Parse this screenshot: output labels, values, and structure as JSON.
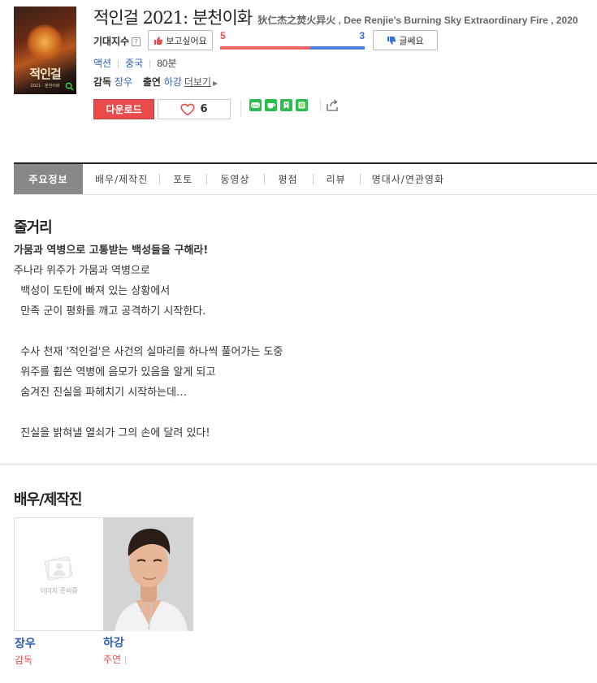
{
  "movie": {
    "title": "적인걸 2021: 분천이화",
    "original_title": "狄仁杰之焚火异火 , Dee Renjie's Burning Sky Extraordinary Fire , 2020",
    "poster_text": "적인걸",
    "poster_sub": "2021 · 분천이화"
  },
  "expectation": {
    "label": "기대지수",
    "help": "?",
    "want_label": "보고싶어요",
    "meh_label": "글쎄요",
    "want_count": "5",
    "meh_count": "3",
    "want_ratio": 0.625
  },
  "meta": {
    "genre": "액션",
    "country": "중국",
    "runtime": "80분"
  },
  "credits": {
    "director_label": "감독",
    "director": "장우",
    "cast_label": "출연",
    "cast": "하강",
    "more": "더보기"
  },
  "actions": {
    "download": "다운로드",
    "like_count": "6"
  },
  "share_icons": [
    "blog-icon",
    "cafe-icon",
    "bookmark-icon",
    "memo-icon"
  ],
  "tabs": [
    "주요정보",
    "배우/제작진",
    "포토",
    "동영상",
    "평점",
    "리뷰",
    "명대사/연관영화"
  ],
  "synopsis": {
    "title": "줄거리",
    "headline": "가뭄과 역병으로 고통받는 백성들을 구해라!",
    "body": "주나라 위주가 가뭄과 역병으로\n  백성이 도탄에 빠져 있는 상황에서\n  만족 군이 평화를 깨고 공격하기 시작한다.\n\n  수사 천재 '적인걸'은 사건의 실마리를 하나씩 풀어가는 도중\n  위주를 휩쓴 역병에 음모가 있음을 알게 되고\n  숨겨진 진실을 파헤치기 시작하는데…\n\n  진실을 밝혀낼 열쇠가 그의 손에 달려 있다!"
  },
  "cast_section": {
    "title": "배우/제작진",
    "placeholder_text": "이미지 준비중",
    "people": [
      {
        "name": "장우",
        "role": "감독"
      },
      {
        "name": "하강",
        "role": "주연"
      }
    ]
  },
  "colors": {
    "accent_red": "#e84b4b",
    "link_blue": "#2f5fb3",
    "score_red": "#f06464",
    "score_blue": "#4f7fd9"
  }
}
